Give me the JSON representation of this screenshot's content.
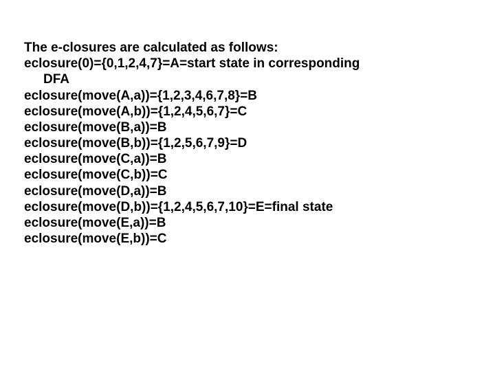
{
  "lines": {
    "l0": "The e-closures are calculated as follows:",
    "l1": "eclosure(0)={0,1,2,4,7}=A=start state in corresponding",
    "l2": "DFA",
    "l3": "eclosure(move(A,a))={1,2,3,4,6,7,8}=B",
    "l4": "eclosure(move(A,b))={1,2,4,5,6,7}=C",
    "l5": "eclosure(move(B,a))=B",
    "l6": "eclosure(move(B,b))={1,2,5,6,7,9}=D",
    "l7": "eclosure(move(C,a))=B",
    "l8": "eclosure(move(C,b))=C",
    "l9": "eclosure(move(D,a))=B",
    "l10": "eclosure(move(D,b))={1,2,4,5,6,7,10}=E=final state",
    "l11": "eclosure(move(E,a))=B",
    "l12": "eclosure(move(E,b))=C"
  }
}
